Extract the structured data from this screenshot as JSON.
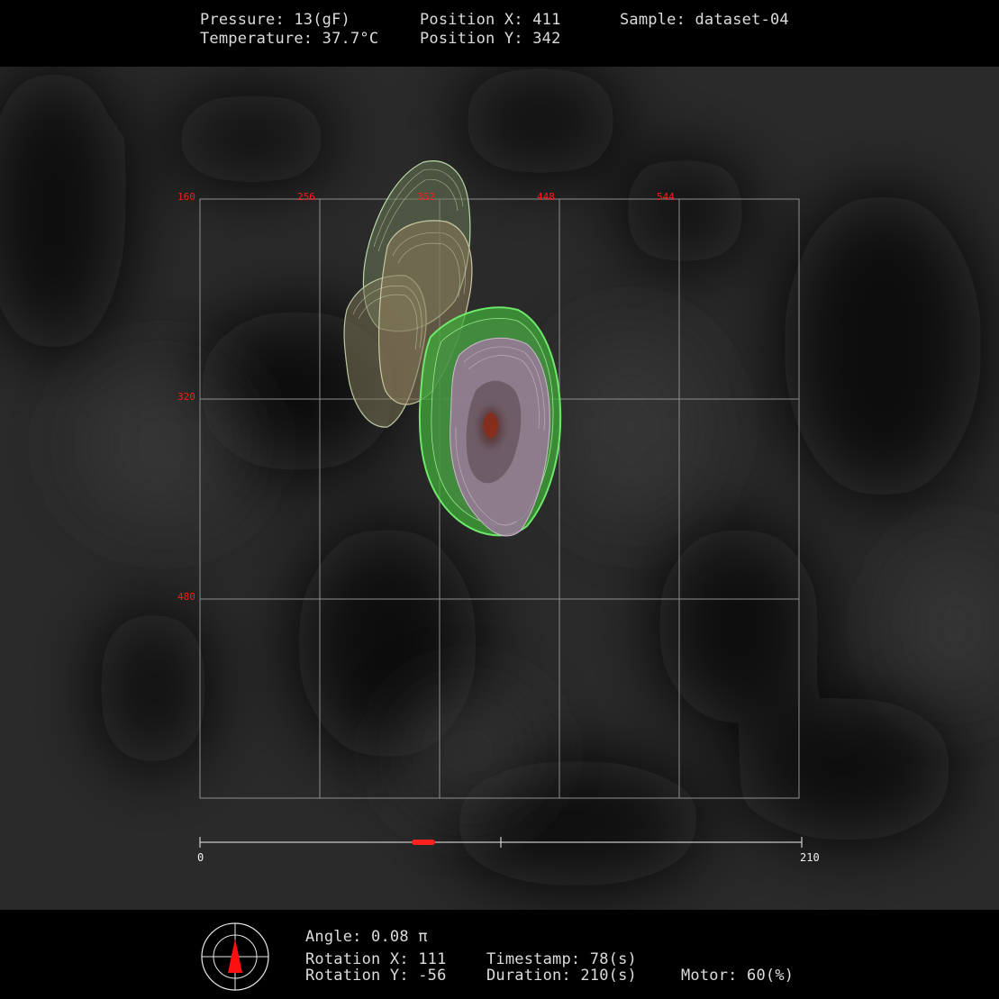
{
  "header": {
    "pressure": "Pressure: 13(gF)",
    "temperature": "Temperature: 37.7°C",
    "position_x": "Position X: 411",
    "position_y": "Position Y: 342",
    "sample": "Sample: dataset-04"
  },
  "plot": {
    "x_ticks": [
      "160",
      "256",
      "352",
      "448",
      "544"
    ],
    "y_ticks": [
      "320",
      "480"
    ],
    "grid_color": "#9a9a9a",
    "tick_color": "#ff1a1a"
  },
  "timeline": {
    "start_label": "0",
    "end_label": "210",
    "current_value": 78,
    "max_value": 210,
    "marker_color": "#ff2020"
  },
  "footer": {
    "angle": "Angle: 0.08 π",
    "rotation_x": "Rotation X: 111",
    "rotation_y": "Rotation Y: -56",
    "timestamp": "Timestamp: 78(s)",
    "duration": "Duration: 210(s)",
    "motor": "Motor: 60(%)",
    "compass_icon": "compass-icon"
  }
}
